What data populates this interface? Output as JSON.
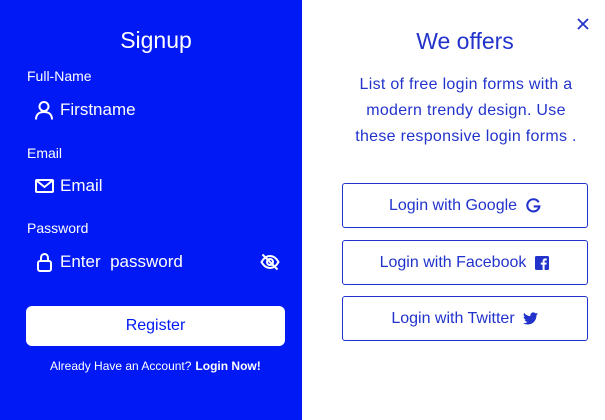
{
  "signup": {
    "title": "Signup",
    "fullname_label": "Full-Name",
    "fullname_placeholder": "Firstname",
    "email_label": "Email",
    "email_placeholder": "Email",
    "password_label": "Password",
    "password_placeholder": "Enter  password",
    "register_label": "Register",
    "account_prompt": "Already Have an Account?",
    "login_link": "Login Now!"
  },
  "offers": {
    "title": "We offers",
    "description": "List of free login forms with a modern trendy design. Use these responsive login forms .",
    "buttons": [
      {
        "label": "Login with Google",
        "icon": "google-icon"
      },
      {
        "label": "Login with Facebook",
        "icon": "facebook-icon"
      },
      {
        "label": "Login with Twitter",
        "icon": "twitter-icon"
      }
    ]
  },
  "icons": {
    "user": "user-icon",
    "email": "mail-icon",
    "lock": "lock-icon",
    "eye": "eye-off-icon",
    "close": "close-icon"
  },
  "colors": {
    "panel_blue": "#0019f5",
    "text_blue": "#2233cc",
    "white": "#ffffff"
  }
}
